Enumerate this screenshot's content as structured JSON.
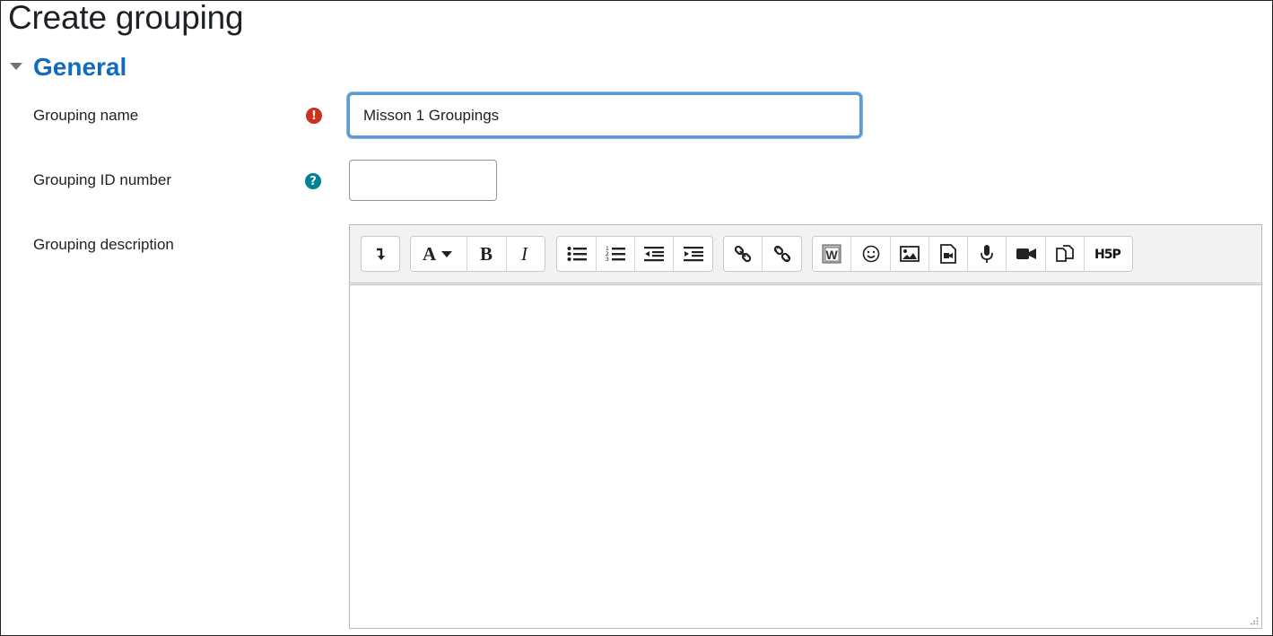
{
  "page": {
    "title": "Create grouping"
  },
  "section": {
    "title": "General",
    "toggle_icon": "caret-down-icon"
  },
  "fields": {
    "grouping_name": {
      "label": "Grouping name",
      "value": "Misson 1 Groupings",
      "icon": "required-exclamation-icon",
      "icon_glyph": "!",
      "icon_color": "#ca3120"
    },
    "grouping_id": {
      "label": "Grouping ID number",
      "value": "",
      "icon": "help-question-icon",
      "icon_glyph": "?",
      "icon_color": "#008196"
    },
    "grouping_description": {
      "label": "Grouping description",
      "value": ""
    }
  },
  "toolbar": {
    "groups": [
      [
        "show-more-buttons-icon"
      ],
      [
        "font-style-icon",
        "bold-icon",
        "italic-icon"
      ],
      [
        "unordered-list-icon",
        "ordered-list-icon",
        "outdent-icon",
        "indent-icon"
      ],
      [
        "link-icon",
        "unlink-icon"
      ],
      [
        "paste-from-word-icon",
        "emoji-icon",
        "image-icon",
        "media-icon",
        "record-audio-icon",
        "record-video-icon",
        "manage-files-icon",
        "h5p-icon"
      ]
    ]
  },
  "colors": {
    "link": "#0f6cbf",
    "focus_border": "#5b9bd5",
    "text": "#1d2125"
  }
}
